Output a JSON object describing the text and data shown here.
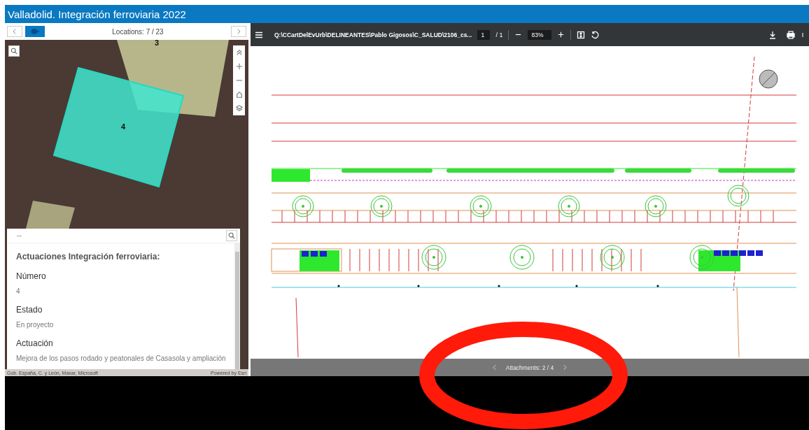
{
  "title": "Valladolid. Integración ferroviaria 2022",
  "nav": {
    "locations": "Locations: 7 / 23"
  },
  "map": {
    "areas": [
      {
        "label": "3",
        "selected": false
      },
      {
        "label": "4",
        "selected": true
      }
    ]
  },
  "popup": {
    "heading": "Actuaciones Integración ferroviaria:",
    "fields": [
      {
        "label": "Número",
        "value": "4"
      },
      {
        "label": "Estado",
        "value": "En proyecto"
      },
      {
        "label": "Actuación",
        "value": "Mejora de los pasos rodado y peatonales de Casasola y ampliación"
      }
    ]
  },
  "attribution": {
    "sources": "Gob. España, C. y León, Maxar, Microsoft",
    "powered": "Powered by Esri"
  },
  "pdf": {
    "path": "Q:\\CCartDelEvUrb\\DELINEANTES\\Pablo Gigosos\\C_SALUD\\2106_cs...",
    "page": "1",
    "total": "/ 1",
    "zoom": "83%"
  },
  "attachments": "Attachments: 2 / 4"
}
